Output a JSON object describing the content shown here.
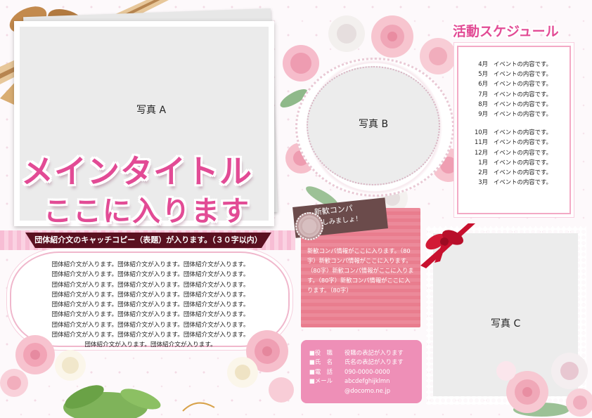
{
  "photo_a": {
    "label": "写真 A"
  },
  "photo_b": {
    "label": "写真 B"
  },
  "photo_c": {
    "label": "写真 C"
  },
  "main_title": {
    "line1": "メインタイトル",
    "line2": "ここに入ります"
  },
  "catch_copy": "団体紹介文のキャッチコピー（表題）が入ります。（３０字以内）",
  "intro_text": "団体紹介文が入ります。団体紹介文が入ります。団体紹介文が入ります。\n団体紹介文が入ります。団体紹介文が入ります。団体紹介文が入ります。\n団体紹介文が入ります。団体紹介文が入ります。団体紹介文が入ります。\n団体紹介文が入ります。団体紹介文が入ります。団体紹介文が入ります。\n団体紹介文が入ります。団体紹介文が入ります。団体紹介文が入ります。\n団体紹介文が入ります。団体紹介文が入ります。団体紹介文が入ります。\n団体紹介文が入ります。団体紹介文が入ります。団体紹介文が入ります。\n団体紹介文が入ります。団体紹介文が入ります。団体紹介文が入ります。\n団体紹介文が入ります。団体紹介文が入ります。",
  "schedule": {
    "title": "活動スケジュール",
    "group1": [
      {
        "month": "4月",
        "text": "イベントの内容です。"
      },
      {
        "month": "5月",
        "text": "イベントの内容です。"
      },
      {
        "month": "6月",
        "text": "イベントの内容です。"
      },
      {
        "month": "7月",
        "text": "イベントの内容です。"
      },
      {
        "month": "8月",
        "text": "イベントの内容です。"
      },
      {
        "month": "9月",
        "text": "イベントの内容です。"
      }
    ],
    "group2": [
      {
        "month": "10月",
        "text": "イベントの内容です。"
      },
      {
        "month": "11月",
        "text": "イベントの内容です。"
      },
      {
        "month": "12月",
        "text": "イベントの内容です。"
      },
      {
        "month": "1月",
        "text": "イベントの内容です。"
      },
      {
        "month": "2月",
        "text": "イベントの内容です。"
      },
      {
        "month": "3月",
        "text": "イベントの内容です。"
      }
    ]
  },
  "welcome_party": {
    "tag_line1": "新歓コンパ",
    "tag_line2": "楽しみましょ！",
    "text": "新歓コンパ情報がここに入ります。（80字）新歓コンパ情報がここに入ります。（80字）新歓コンパ情報がここに入ります。（80字）新歓コンパ情報がここに入ります。（80字）"
  },
  "contact": {
    "rows": [
      {
        "label": "■役　職",
        "value": "役職の表記が入ります"
      },
      {
        "label": "■氏　名",
        "value": "氏名の表記が入ります"
      },
      {
        "label": "■電　話",
        "value": "090-0000-0000"
      },
      {
        "label": "■メール",
        "value": "abcdefghijklmn"
      },
      {
        "label": "",
        "value": "@docomo.ne.jp"
      }
    ]
  },
  "colors": {
    "title_pink": "#e24b95",
    "band_dark": "#5a1020",
    "party_coral": "#ec8a9a",
    "contact_pink": "#ee8fb7",
    "ribbon_gold": "#c99b5f"
  }
}
